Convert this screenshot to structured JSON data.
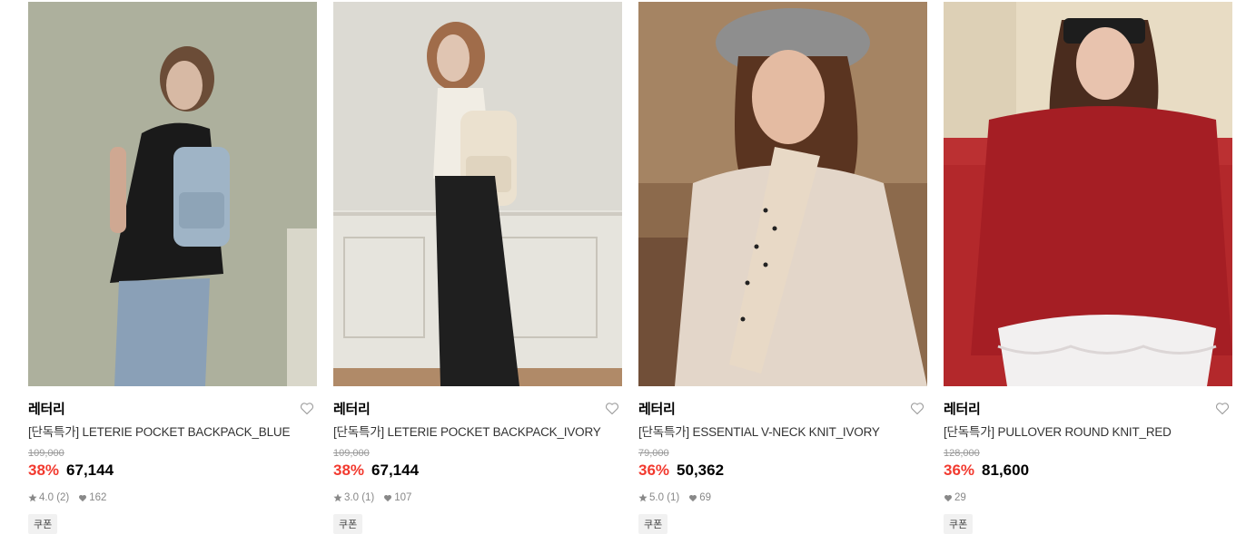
{
  "products": [
    {
      "brand": "레터리",
      "title": "[단독특가] LETERIE POCKET BACKPACK_BLUE",
      "original_price": "109,000",
      "discount": "38%",
      "price": "67,144",
      "rating": "4.0",
      "review_count": "(2)",
      "likes": "162",
      "coupon": "쿠폰",
      "image_desc": "model-blue-backpack"
    },
    {
      "brand": "레터리",
      "title": "[단독특가] LETERIE POCKET BACKPACK_IVORY",
      "original_price": "109,000",
      "discount": "38%",
      "price": "67,144",
      "rating": "3.0",
      "review_count": "(1)",
      "likes": "107",
      "coupon": "쿠폰",
      "image_desc": "model-ivory-backpack"
    },
    {
      "brand": "레터리",
      "title": "[단독특가] ESSENTIAL V-NECK KNIT_IVORY",
      "original_price": "79,000",
      "discount": "36%",
      "price": "50,362",
      "rating": "5.0",
      "review_count": "(1)",
      "likes": "69",
      "coupon": "쿠폰",
      "image_desc": "model-ivory-knit-beret"
    },
    {
      "brand": "레터리",
      "title": "[단독특가] PULLOVER ROUND KNIT_RED",
      "original_price": "128,000",
      "discount": "36%",
      "price": "81,600",
      "likes": "29",
      "coupon": "쿠폰",
      "image_desc": "model-red-knit"
    }
  ],
  "colors": {
    "discount": "#f23a2f",
    "price": "#000000",
    "muted": "#888888"
  }
}
